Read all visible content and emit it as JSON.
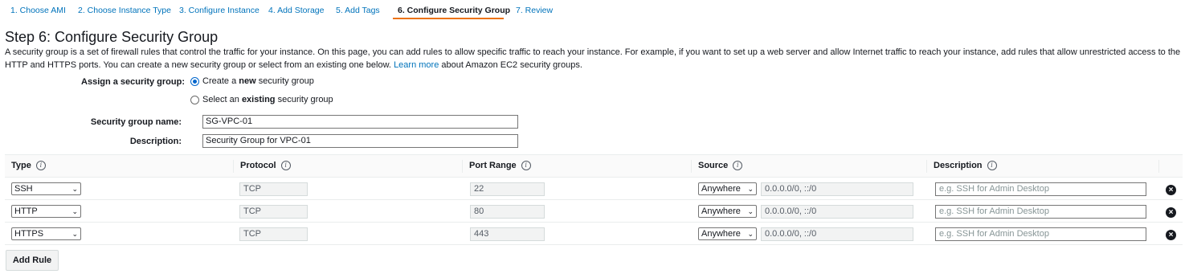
{
  "wizard": {
    "steps": [
      {
        "label": "1. Choose AMI"
      },
      {
        "label": "2. Choose Instance Type"
      },
      {
        "label": "3. Configure Instance"
      },
      {
        "label": "4. Add Storage"
      },
      {
        "label": "5. Add Tags"
      },
      {
        "label": "6. Configure Security Group",
        "active": true
      },
      {
        "label": "7. Review"
      }
    ],
    "accent_color": "#ec7211"
  },
  "page": {
    "title": "Step 6: Configure Security Group",
    "intro_text": "A security group is a set of firewall rules that control the traffic for your instance. On this page, you can add rules to allow specific traffic to reach your instance. For example, if you want to set up a web server and allow Internet traffic to reach your instance, add rules that allow unrestricted access to the HTTP and HTTPS ports. You can create a new security group or select from an existing one below.",
    "learn_more": "Learn more",
    "intro_suffix": "about Amazon EC2 security groups."
  },
  "assign": {
    "label": "Assign a security group:",
    "option_new_pre": "Create a",
    "option_new_bold": "new",
    "option_new_post": "security group",
    "option_existing_pre": "Select an",
    "option_existing_bold": "existing",
    "option_existing_post": "security group"
  },
  "form": {
    "name_label": "Security group name:",
    "name_value": "SG-VPC-01",
    "desc_label": "Description:",
    "desc_value": "Security Group for VPC-01"
  },
  "table": {
    "headers": {
      "type": "Type",
      "protocol": "Protocol",
      "port_range": "Port Range",
      "source": "Source",
      "description": "Description"
    },
    "info_icon": "i",
    "rows": [
      {
        "type": "SSH",
        "protocol": "TCP",
        "port": "22",
        "source": "Anywhere",
        "cidr": "0.0.0.0/0, ::/0",
        "desc_placeholder": "e.g. SSH for Admin Desktop"
      },
      {
        "type": "HTTP",
        "protocol": "TCP",
        "port": "80",
        "source": "Anywhere",
        "cidr": "0.0.0.0/0, ::/0",
        "desc_placeholder": "e.g. SSH for Admin Desktop"
      },
      {
        "type": "HTTPS",
        "protocol": "TCP",
        "port": "443",
        "source": "Anywhere",
        "cidr": "0.0.0.0/0, ::/0",
        "desc_placeholder": "e.g. SSH for Admin Desktop"
      }
    ]
  },
  "add_rule_label": "Add Rule",
  "icons": {
    "remove": "close-circle-icon",
    "info": "info-icon",
    "chevron": "chevron-down-icon"
  }
}
